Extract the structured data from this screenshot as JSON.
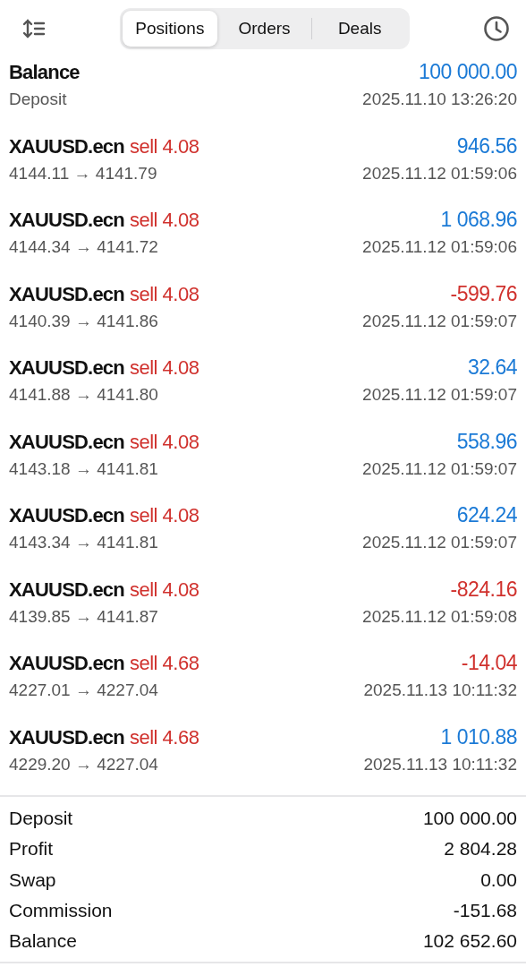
{
  "tabs": [
    {
      "label": "Positions",
      "selected": true
    },
    {
      "label": "Orders",
      "selected": false
    },
    {
      "label": "Deals",
      "selected": false
    }
  ],
  "deals": [
    {
      "kind": "balance",
      "title": "Balance",
      "value": "100 000.00",
      "negative": false,
      "detail": "Deposit",
      "time": "2025.11.10 13:26:20"
    },
    {
      "kind": "trade",
      "title": "XAUUSD.ecn",
      "side": "sell 4.08",
      "value": "946.56",
      "negative": false,
      "detail": "4144.11 → 4141.79",
      "time": "2025.11.12 01:59:06"
    },
    {
      "kind": "trade",
      "title": "XAUUSD.ecn",
      "side": "sell 4.08",
      "value": "1 068.96",
      "negative": false,
      "detail": "4144.34 → 4141.72",
      "time": "2025.11.12 01:59:06"
    },
    {
      "kind": "trade",
      "title": "XAUUSD.ecn",
      "side": "sell 4.08",
      "value": "-599.76",
      "negative": true,
      "detail": "4140.39 → 4141.86",
      "time": "2025.11.12 01:59:07"
    },
    {
      "kind": "trade",
      "title": "XAUUSD.ecn",
      "side": "sell 4.08",
      "value": "32.64",
      "negative": false,
      "detail": "4141.88 → 4141.80",
      "time": "2025.11.12 01:59:07"
    },
    {
      "kind": "trade",
      "title": "XAUUSD.ecn",
      "side": "sell 4.08",
      "value": "558.96",
      "negative": false,
      "detail": "4143.18 → 4141.81",
      "time": "2025.11.12 01:59:07"
    },
    {
      "kind": "trade",
      "title": "XAUUSD.ecn",
      "side": "sell 4.08",
      "value": "624.24",
      "negative": false,
      "detail": "4143.34 → 4141.81",
      "time": "2025.11.12 01:59:07"
    },
    {
      "kind": "trade",
      "title": "XAUUSD.ecn",
      "side": "sell 4.08",
      "value": "-824.16",
      "negative": true,
      "detail": "4139.85 → 4141.87",
      "time": "2025.11.12 01:59:08"
    },
    {
      "kind": "trade",
      "title": "XAUUSD.ecn",
      "side": "sell 4.68",
      "value": "-14.04",
      "negative": true,
      "detail": "4227.01 → 4227.04",
      "time": "2025.11.13 10:11:32"
    },
    {
      "kind": "trade",
      "title": "XAUUSD.ecn",
      "side": "sell 4.68",
      "value": "1 010.88",
      "negative": false,
      "detail": "4229.20 → 4227.04",
      "time": "2025.11.13 10:11:32"
    }
  ],
  "summary": [
    {
      "label": "Deposit",
      "value": "100 000.00"
    },
    {
      "label": "Profit",
      "value": "2 804.28"
    },
    {
      "label": "Swap",
      "value": "0.00"
    },
    {
      "label": "Commission",
      "value": "-151.68"
    },
    {
      "label": "Balance",
      "value": "102 652.60"
    }
  ]
}
